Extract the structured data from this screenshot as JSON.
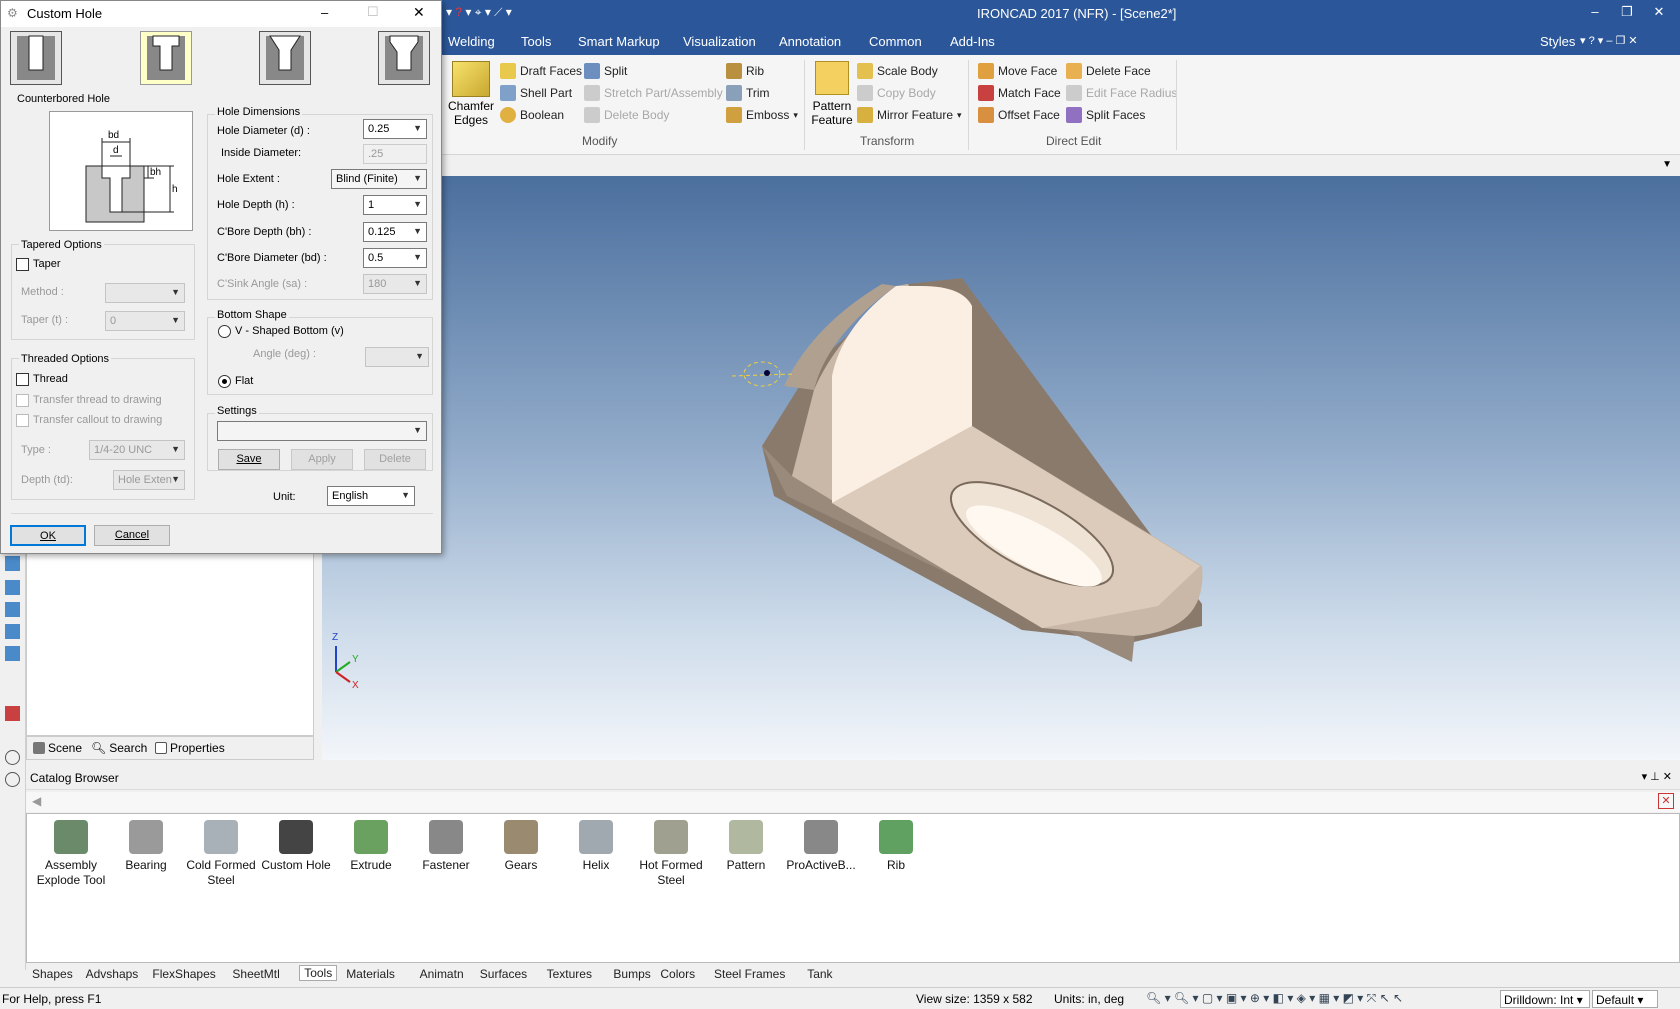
{
  "app": {
    "title": "IRONCAD 2017 (NFR) - [Scene2*]",
    "styles_label": "Styles"
  },
  "ribbon_tabs": [
    "Welding",
    "Tools",
    "Smart Markup",
    "Visualization",
    "Annotation",
    "Common",
    "Add-Ins"
  ],
  "ribbon": {
    "chamfer": "Chamfer\nEdges",
    "modify": {
      "draft_faces": "Draft Faces",
      "shell_part": "Shell Part",
      "boolean": "Boolean",
      "split": "Split",
      "stretch": "Stretch Part/Assembly",
      "delete_body": "Delete Body",
      "rib": "Rib",
      "trim": "Trim",
      "emboss": "Emboss",
      "group": "Modify"
    },
    "transform": {
      "pattern": "Pattern\nFeature",
      "scale_body": "Scale Body",
      "copy_body": "Copy Body",
      "mirror": "Mirror Feature",
      "group": "Transform"
    },
    "direct_edit": {
      "move_face": "Move Face",
      "match_face": "Match Face",
      "offset_face": "Offset Face",
      "delete_face": "Delete Face",
      "edit_face_radius": "Edit Face Radius",
      "split_faces": "Split Faces",
      "group": "Direct Edit"
    }
  },
  "dialog": {
    "title": "Custom Hole",
    "hole_type_label": "Counterbored Hole",
    "hole_dimensions": {
      "title": "Hole Dimensions",
      "hole_diameter_label": "Hole Diameter (d) :",
      "hole_diameter": "0.25",
      "inside_diameter_label": "Inside Diameter:",
      "inside_diameter": ".25",
      "hole_extent_label": "Hole Extent :",
      "hole_extent": "Blind (Finite)",
      "hole_depth_label": "Hole Depth (h) :",
      "hole_depth": "1",
      "cbore_depth_label": "C'Bore Depth (bh) :",
      "cbore_depth": "0.125",
      "cbore_diameter_label": "C'Bore Diameter (bd) :",
      "cbore_diameter": "0.5",
      "csink_angle_label": "C'Sink Angle (sa) :",
      "csink_angle": "180"
    },
    "diagram": {
      "bd": "bd",
      "d": "d",
      "bh": "bh",
      "h": "h"
    },
    "tapered": {
      "title": "Tapered Options",
      "taper": "Taper",
      "method_label": "Method :",
      "method": "",
      "taper_t_label": "Taper (t) :",
      "taper_t": "0"
    },
    "threaded": {
      "title": "Threaded Options",
      "thread": "Thread",
      "transfer_thread": "Transfer thread to drawing",
      "transfer_callout": "Transfer callout to drawing",
      "type_label": "Type :",
      "type": "1/4-20 UNC",
      "depth_label": "Depth (td):",
      "depth": "Hole Exten"
    },
    "bottom": {
      "title": "Bottom Shape",
      "vshape": "V - Shaped Bottom (v)",
      "angle_label": "Angle (deg) :",
      "angle": "",
      "flat": "Flat"
    },
    "settings": {
      "title": "Settings",
      "value": "",
      "save": "Save",
      "apply": "Apply",
      "delete": "Delete"
    },
    "unit_label": "Unit:",
    "unit": "English",
    "ok": "OK",
    "cancel": "Cancel"
  },
  "scene_tabs": [
    "Scene",
    "Search",
    "Properties"
  ],
  "catalog": {
    "title": "Catalog Browser",
    "items": [
      "Assembly\nExplode Tool",
      "Bearing",
      "Cold Formed\nSteel",
      "Custom Hole",
      "Extrude",
      "Fastener",
      "Gears",
      "Helix",
      "Hot Formed\nSteel",
      "Pattern",
      "ProActiveB...",
      "Rib"
    ]
  },
  "catalog_tabs": [
    "Shapes",
    "Advshaps",
    "FlexShapes",
    "SheetMtl",
    "Tools",
    "Materials",
    "Animatn",
    "Surfaces",
    "Textures",
    "Bumps",
    "Colors",
    "Steel Frames",
    "Tank"
  ],
  "status": {
    "help": "For Help, press F1",
    "view_size": "View size: 1359 x  582",
    "units": "Units: in, deg",
    "drilldown": "Drilldown: Int",
    "default": "Default"
  },
  "triad": {
    "z": "Z",
    "y": "Y",
    "x": "X"
  },
  "colors": {
    "accent": "#2b579a",
    "part": "#e8dcd0",
    "highlight": "#ffffc8"
  }
}
